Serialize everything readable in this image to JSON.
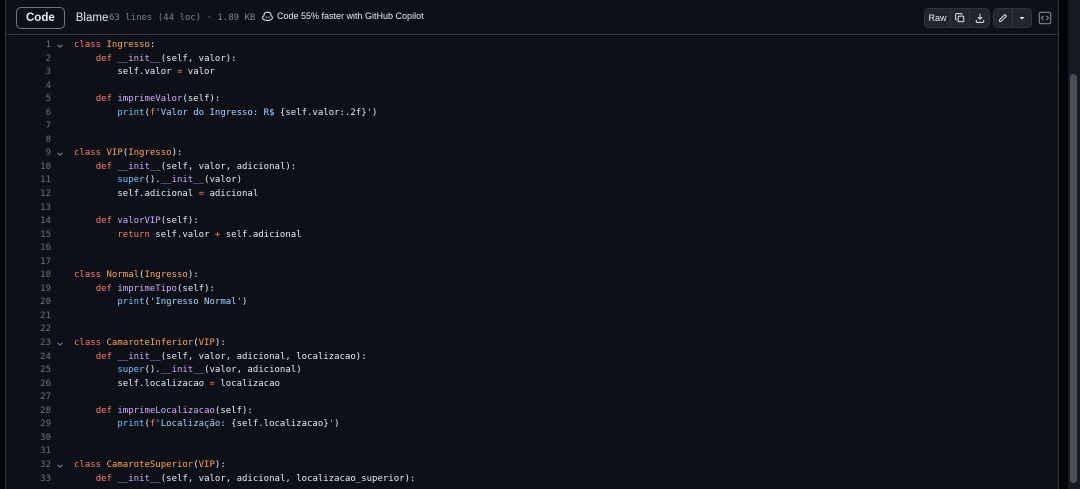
{
  "toolbar": {
    "code_label": "Code",
    "blame_label": "Blame",
    "file_info": "63 lines (44 loc) · 1.89 KB",
    "copilot_text": "Code 55% faster with GitHub Copilot",
    "raw_label": "Raw",
    "icons": [
      "copilot-icon",
      "copy-icon",
      "download-icon",
      "pencil-icon",
      "triangle-down-icon",
      "code-square-icon"
    ]
  },
  "colors": {
    "keyword": "#ff7b72",
    "classname": "#ffa657",
    "function": "#d2a8ff",
    "builtin": "#79c0ff",
    "string": "#a5d6ff",
    "default": "#e6edf3",
    "line_number": "#6e7681",
    "background": "#0d1117"
  },
  "code": {
    "lines": [
      {
        "n": "1",
        "fold": true,
        "tokens": [
          [
            "k",
            "class "
          ],
          [
            "c",
            "Ingresso"
          ],
          [
            "d",
            ":"
          ]
        ]
      },
      {
        "n": "2",
        "fold": false,
        "tokens": [
          [
            "d",
            "    "
          ],
          [
            "k",
            "def "
          ],
          [
            "f",
            "__init__"
          ],
          [
            "d",
            "(self, valor):"
          ]
        ]
      },
      {
        "n": "3",
        "fold": false,
        "tokens": [
          [
            "d",
            "        self.valor "
          ],
          [
            "k",
            "="
          ],
          [
            "d",
            " valor"
          ]
        ]
      },
      {
        "n": "4",
        "fold": false,
        "tokens": []
      },
      {
        "n": "5",
        "fold": false,
        "tokens": [
          [
            "d",
            "    "
          ],
          [
            "k",
            "def "
          ],
          [
            "f",
            "imprimeValor"
          ],
          [
            "d",
            "(self):"
          ]
        ]
      },
      {
        "n": "6",
        "fold": false,
        "tokens": [
          [
            "d",
            "        "
          ],
          [
            "b",
            "print"
          ],
          [
            "d",
            "("
          ],
          [
            "k",
            "f"
          ],
          [
            "s",
            "'Valor do Ingresso: R$ "
          ],
          [
            "d",
            "{self.valor:.2f}"
          ],
          [
            "s",
            "'"
          ],
          [
            "d",
            ")"
          ]
        ]
      },
      {
        "n": "7",
        "fold": false,
        "tokens": []
      },
      {
        "n": "8",
        "fold": false,
        "tokens": []
      },
      {
        "n": "9",
        "fold": true,
        "tokens": [
          [
            "k",
            "class "
          ],
          [
            "c",
            "VIP"
          ],
          [
            "d",
            "("
          ],
          [
            "c",
            "Ingresso"
          ],
          [
            "d",
            "):"
          ]
        ]
      },
      {
        "n": "10",
        "fold": false,
        "tokens": [
          [
            "d",
            "    "
          ],
          [
            "k",
            "def "
          ],
          [
            "f",
            "__init__"
          ],
          [
            "d",
            "(self, valor, adicional):"
          ]
        ]
      },
      {
        "n": "11",
        "fold": false,
        "tokens": [
          [
            "d",
            "        "
          ],
          [
            "b",
            "super"
          ],
          [
            "d",
            "()."
          ],
          [
            "f",
            "__init__"
          ],
          [
            "d",
            "(valor)"
          ]
        ]
      },
      {
        "n": "12",
        "fold": false,
        "tokens": [
          [
            "d",
            "        self.adicional "
          ],
          [
            "k",
            "="
          ],
          [
            "d",
            " adicional"
          ]
        ]
      },
      {
        "n": "13",
        "fold": false,
        "tokens": []
      },
      {
        "n": "14",
        "fold": false,
        "tokens": [
          [
            "d",
            "    "
          ],
          [
            "k",
            "def "
          ],
          [
            "f",
            "valorVIP"
          ],
          [
            "d",
            "(self):"
          ]
        ]
      },
      {
        "n": "15",
        "fold": false,
        "tokens": [
          [
            "d",
            "        "
          ],
          [
            "k",
            "return "
          ],
          [
            "d",
            "self.valor "
          ],
          [
            "k",
            "+"
          ],
          [
            "d",
            " self.adicional"
          ]
        ]
      },
      {
        "n": "16",
        "fold": false,
        "tokens": []
      },
      {
        "n": "17",
        "fold": false,
        "tokens": []
      },
      {
        "n": "18",
        "fold": false,
        "tokens": [
          [
            "k",
            "class "
          ],
          [
            "c",
            "Normal"
          ],
          [
            "d",
            "("
          ],
          [
            "c",
            "Ingresso"
          ],
          [
            "d",
            "):"
          ]
        ]
      },
      {
        "n": "19",
        "fold": false,
        "tokens": [
          [
            "d",
            "    "
          ],
          [
            "k",
            "def "
          ],
          [
            "f",
            "imprimeTipo"
          ],
          [
            "d",
            "(self):"
          ]
        ]
      },
      {
        "n": "20",
        "fold": false,
        "tokens": [
          [
            "d",
            "        "
          ],
          [
            "b",
            "print"
          ],
          [
            "d",
            "("
          ],
          [
            "s",
            "'Ingresso Normal'"
          ],
          [
            "d",
            ")"
          ]
        ]
      },
      {
        "n": "21",
        "fold": false,
        "tokens": []
      },
      {
        "n": "22",
        "fold": false,
        "tokens": []
      },
      {
        "n": "23",
        "fold": true,
        "tokens": [
          [
            "k",
            "class "
          ],
          [
            "c",
            "CamaroteInferior"
          ],
          [
            "d",
            "("
          ],
          [
            "c",
            "VIP"
          ],
          [
            "d",
            "):"
          ]
        ]
      },
      {
        "n": "24",
        "fold": false,
        "tokens": [
          [
            "d",
            "    "
          ],
          [
            "k",
            "def "
          ],
          [
            "f",
            "__init__"
          ],
          [
            "d",
            "(self, valor, adicional, localizacao):"
          ]
        ]
      },
      {
        "n": "25",
        "fold": false,
        "tokens": [
          [
            "d",
            "        "
          ],
          [
            "b",
            "super"
          ],
          [
            "d",
            "()."
          ],
          [
            "f",
            "__init__"
          ],
          [
            "d",
            "(valor, adicional)"
          ]
        ]
      },
      {
        "n": "26",
        "fold": false,
        "tokens": [
          [
            "d",
            "        self.localizacao "
          ],
          [
            "k",
            "="
          ],
          [
            "d",
            " localizacao"
          ]
        ]
      },
      {
        "n": "27",
        "fold": false,
        "tokens": []
      },
      {
        "n": "28",
        "fold": false,
        "tokens": [
          [
            "d",
            "    "
          ],
          [
            "k",
            "def "
          ],
          [
            "f",
            "imprimeLocalizacao"
          ],
          [
            "d",
            "(self):"
          ]
        ]
      },
      {
        "n": "29",
        "fold": false,
        "tokens": [
          [
            "d",
            "        "
          ],
          [
            "b",
            "print"
          ],
          [
            "d",
            "("
          ],
          [
            "k",
            "f"
          ],
          [
            "s",
            "'Localização: "
          ],
          [
            "d",
            "{self.localizacao}"
          ],
          [
            "s",
            "'"
          ],
          [
            "d",
            ")"
          ]
        ]
      },
      {
        "n": "30",
        "fold": false,
        "tokens": []
      },
      {
        "n": "31",
        "fold": false,
        "tokens": []
      },
      {
        "n": "32",
        "fold": true,
        "tokens": [
          [
            "k",
            "class "
          ],
          [
            "c",
            "CamaroteSuperior"
          ],
          [
            "d",
            "("
          ],
          [
            "c",
            "VIP"
          ],
          [
            "d",
            "):"
          ]
        ]
      },
      {
        "n": "33",
        "fold": false,
        "tokens": [
          [
            "d",
            "    "
          ],
          [
            "k",
            "def "
          ],
          [
            "f",
            "__init__"
          ],
          [
            "d",
            "(self, valor, adicional, localizacao_superior):"
          ]
        ]
      }
    ]
  }
}
